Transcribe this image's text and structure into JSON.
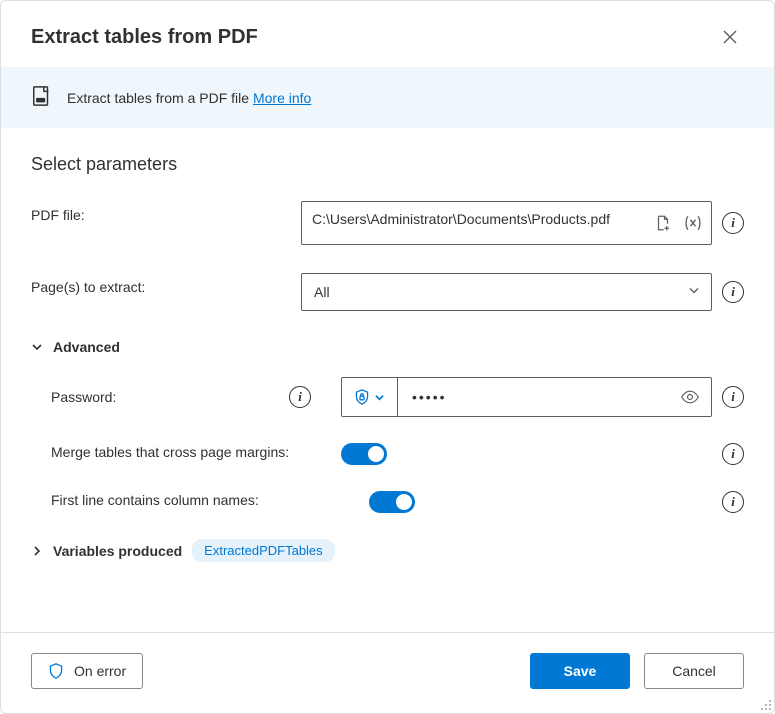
{
  "header": {
    "title": "Extract tables from PDF"
  },
  "banner": {
    "text": "Extract tables from a PDF file",
    "link_text": "More info"
  },
  "section_title": "Select parameters",
  "fields": {
    "pdf_file": {
      "label": "PDF file:",
      "value": "C:\\Users\\Administrator\\Documents\\Products.pdf"
    },
    "pages": {
      "label": "Page(s) to extract:",
      "value": "All"
    }
  },
  "advanced": {
    "title": "Advanced",
    "password": {
      "label": "Password:",
      "masked": "•••••"
    },
    "merge": {
      "label": "Merge tables that cross page margins:",
      "value": true
    },
    "first_line": {
      "label": "First line contains column names:",
      "value": true
    }
  },
  "variables": {
    "title": "Variables produced",
    "items": [
      "ExtractedPDFTables"
    ]
  },
  "footer": {
    "on_error": "On error",
    "save": "Save",
    "cancel": "Cancel"
  }
}
